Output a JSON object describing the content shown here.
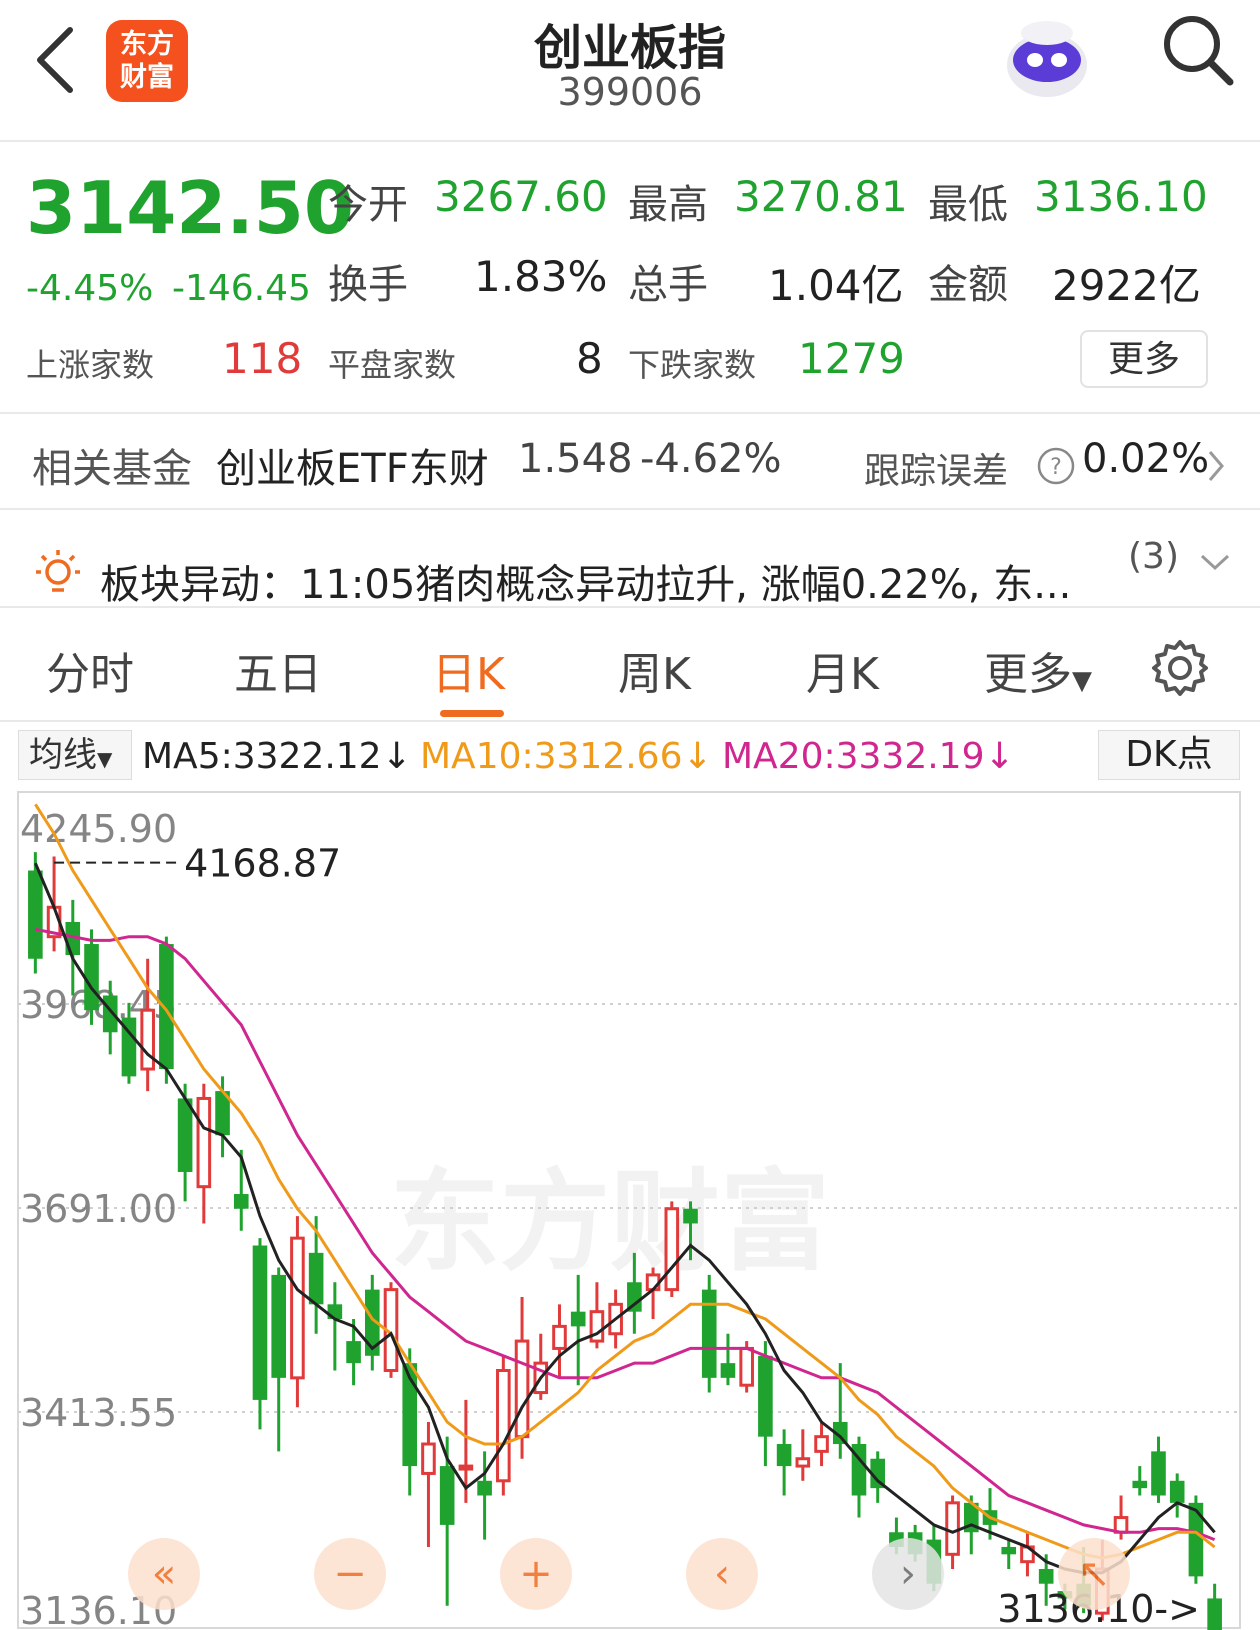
{
  "header": {
    "title": "创业板指",
    "code": "399006",
    "logo_line1": "东方",
    "logo_line2": "财富"
  },
  "quote": {
    "price": "3142.50",
    "change_pct": "-4.45%",
    "change": "-146.45",
    "open_label": "今开",
    "open": "3267.60",
    "high_label": "最高",
    "high": "3270.81",
    "low_label": "最低",
    "low": "3136.10",
    "turnover_label": "换手",
    "turnover": "1.83%",
    "volume_label": "总手",
    "volume": "1.04亿",
    "amount_label": "金额",
    "amount": "2922亿",
    "up_label": "上涨家数",
    "up": "118",
    "flat_label": "平盘家数",
    "flat": "8",
    "down_label": "下跌家数",
    "down": "1279",
    "more": "更多"
  },
  "fund": {
    "label": "相关基金",
    "name": "创业板ETF东财",
    "price": "1.548",
    "pct": "-4.62%",
    "err_label": "跟踪误差",
    "err": "0.02%"
  },
  "alert": {
    "text": "板块异动：11:05猪肉概念异动拉升, 涨幅0.22%, 东...",
    "count": "(3)"
  },
  "tabs": [
    "分时",
    "五日",
    "日K",
    "周K",
    "月K",
    "更多"
  ],
  "ma": {
    "selector": "均线",
    "ma5": "MA5:3322.12↓",
    "ma10": "MA10:3312.66↓",
    "ma20": "MA20:3332.19↓",
    "dk": "DK点",
    "ma5_color": "#222222",
    "ma10_color": "#f09a1a",
    "ma20_color": "#d0268f"
  },
  "chart_data": {
    "type": "candlestick",
    "y_ticks": [
      "4245.90",
      "3968.45",
      "3691.00",
      "3413.55",
      "3136.10"
    ],
    "ylim": [
      3136.1,
      4245.9
    ],
    "high_annotation": "4168.87",
    "low_annotation": "3136.10->",
    "watermark": "东方财富",
    "up_color": "#e03a3a",
    "down_color": "#1fa22e",
    "candles": [
      {
        "o": 4150,
        "c": 4030,
        "h": 4175,
        "l": 4010
      },
      {
        "o": 4060,
        "c": 4100,
        "h": 4169,
        "l": 4040
      },
      {
        "o": 4080,
        "c": 4035,
        "h": 4110,
        "l": 3980
      },
      {
        "o": 4050,
        "c": 3960,
        "h": 4070,
        "l": 3940
      },
      {
        "o": 3980,
        "c": 3930,
        "h": 4000,
        "l": 3900
      },
      {
        "o": 3950,
        "c": 3870,
        "h": 3970,
        "l": 3860
      },
      {
        "o": 3880,
        "c": 3960,
        "h": 4030,
        "l": 3850
      },
      {
        "o": 4050,
        "c": 3880,
        "h": 4060,
        "l": 3860
      },
      {
        "o": 3840,
        "c": 3740,
        "h": 3860,
        "l": 3700
      },
      {
        "o": 3720,
        "c": 3840,
        "h": 3860,
        "l": 3670
      },
      {
        "o": 3850,
        "c": 3790,
        "h": 3870,
        "l": 3760
      },
      {
        "o": 3710,
        "c": 3690,
        "h": 3770,
        "l": 3660
      },
      {
        "o": 3640,
        "c": 3430,
        "h": 3650,
        "l": 3390
      },
      {
        "o": 3600,
        "c": 3460,
        "h": 3610,
        "l": 3360
      },
      {
        "o": 3460,
        "c": 3650,
        "h": 3680,
        "l": 3420
      },
      {
        "o": 3630,
        "c": 3560,
        "h": 3680,
        "l": 3520
      },
      {
        "o": 3560,
        "c": 3540,
        "h": 3590,
        "l": 3470
      },
      {
        "o": 3510,
        "c": 3480,
        "h": 3540,
        "l": 3450
      },
      {
        "o": 3580,
        "c": 3490,
        "h": 3600,
        "l": 3470
      },
      {
        "o": 3470,
        "c": 3580,
        "h": 3590,
        "l": 3460
      },
      {
        "o": 3480,
        "c": 3340,
        "h": 3500,
        "l": 3300
      },
      {
        "o": 3330,
        "c": 3370,
        "h": 3400,
        "l": 3230
      },
      {
        "o": 3340,
        "c": 3260,
        "h": 3380,
        "l": 3150
      },
      {
        "o": 3340,
        "c": 3340,
        "h": 3430,
        "l": 3290
      },
      {
        "o": 3320,
        "c": 3300,
        "h": 3360,
        "l": 3240
      },
      {
        "o": 3320,
        "c": 3470,
        "h": 3490,
        "l": 3300
      },
      {
        "o": 3380,
        "c": 3510,
        "h": 3570,
        "l": 3350
      },
      {
        "o": 3440,
        "c": 3480,
        "h": 3520,
        "l": 3430
      },
      {
        "o": 3500,
        "c": 3530,
        "h": 3560,
        "l": 3460
      },
      {
        "o": 3550,
        "c": 3530,
        "h": 3600,
        "l": 3450
      },
      {
        "o": 3510,
        "c": 3550,
        "h": 3590,
        "l": 3500
      },
      {
        "o": 3520,
        "c": 3560,
        "h": 3580,
        "l": 3500
      },
      {
        "o": 3590,
        "c": 3550,
        "h": 3630,
        "l": 3520
      },
      {
        "o": 3580,
        "c": 3600,
        "h": 3610,
        "l": 3540
      },
      {
        "o": 3580,
        "c": 3690,
        "h": 3700,
        "l": 3570
      },
      {
        "o": 3690,
        "c": 3670,
        "h": 3700,
        "l": 3620
      },
      {
        "o": 3580,
        "c": 3460,
        "h": 3600,
        "l": 3440
      },
      {
        "o": 3480,
        "c": 3460,
        "h": 3520,
        "l": 3450
      },
      {
        "o": 3450,
        "c": 3500,
        "h": 3510,
        "l": 3440
      },
      {
        "o": 3490,
        "c": 3380,
        "h": 3510,
        "l": 3340
      },
      {
        "o": 3370,
        "c": 3340,
        "h": 3390,
        "l": 3300
      },
      {
        "o": 3340,
        "c": 3350,
        "h": 3390,
        "l": 3320
      },
      {
        "o": 3360,
        "c": 3380,
        "h": 3400,
        "l": 3340
      },
      {
        "o": 3400,
        "c": 3370,
        "h": 3480,
        "l": 3350
      },
      {
        "o": 3370,
        "c": 3300,
        "h": 3380,
        "l": 3270
      },
      {
        "o": 3350,
        "c": 3310,
        "h": 3360,
        "l": 3290
      },
      {
        "o": 3250,
        "c": 3230,
        "h": 3270,
        "l": 3220
      },
      {
        "o": 3250,
        "c": 3220,
        "h": 3260,
        "l": 3210
      },
      {
        "o": 3240,
        "c": 3180,
        "h": 3260,
        "l": 3170
      },
      {
        "o": 3220,
        "c": 3290,
        "h": 3300,
        "l": 3200
      },
      {
        "o": 3290,
        "c": 3250,
        "h": 3300,
        "l": 3220
      },
      {
        "o": 3280,
        "c": 3260,
        "h": 3310,
        "l": 3240
      },
      {
        "o": 3230,
        "c": 3220,
        "h": 3240,
        "l": 3200
      },
      {
        "o": 3210,
        "c": 3230,
        "h": 3250,
        "l": 3190
      },
      {
        "o": 3200,
        "c": 3180,
        "h": 3220,
        "l": 3150
      },
      {
        "o": 3170,
        "c": 3160,
        "h": 3180,
        "l": 3145
      },
      {
        "o": 3180,
        "c": 3150,
        "h": 3230,
        "l": 3140
      },
      {
        "o": 3140,
        "c": 3200,
        "h": 3240,
        "l": 3130
      },
      {
        "o": 3250,
        "c": 3270,
        "h": 3300,
        "l": 3240
      },
      {
        "o": 3320,
        "c": 3310,
        "h": 3340,
        "l": 3300
      },
      {
        "o": 3360,
        "c": 3300,
        "h": 3380,
        "l": 3290
      },
      {
        "o": 3320,
        "c": 3290,
        "h": 3330,
        "l": 3270
      },
      {
        "o": 3290,
        "c": 3190,
        "h": 3300,
        "l": 3180
      },
      {
        "o": 3160,
        "c": 3030,
        "h": 3180,
        "l": 3010
      }
    ],
    "ma5": [
      4160,
      4100,
      4030,
      3990,
      3960,
      3930,
      3900,
      3880,
      3840,
      3800,
      3790,
      3760,
      3680,
      3620,
      3580,
      3560,
      3540,
      3530,
      3500,
      3520,
      3460,
      3420,
      3350,
      3310,
      3330,
      3370,
      3420,
      3460,
      3490,
      3510,
      3520,
      3540,
      3560,
      3580,
      3610,
      3640,
      3620,
      3590,
      3560,
      3520,
      3470,
      3440,
      3400,
      3380,
      3350,
      3320,
      3300,
      3280,
      3260,
      3250,
      3260,
      3250,
      3240,
      3230,
      3210,
      3200,
      3195,
      3195,
      3210,
      3240,
      3270,
      3290,
      3280,
      3250
    ],
    "ma10": [
      4240,
      4200,
      4150,
      4110,
      4070,
      4030,
      3990,
      3960,
      3920,
      3880,
      3850,
      3820,
      3780,
      3730,
      3690,
      3660,
      3620,
      3580,
      3540,
      3520,
      3480,
      3440,
      3400,
      3380,
      3370,
      3370,
      3380,
      3400,
      3420,
      3440,
      3470,
      3490,
      3510,
      3520,
      3540,
      3560,
      3560,
      3560,
      3550,
      3540,
      3520,
      3500,
      3480,
      3460,
      3430,
      3410,
      3380,
      3360,
      3340,
      3310,
      3290,
      3270,
      3260,
      3250,
      3240,
      3230,
      3220,
      3215,
      3220,
      3230,
      3240,
      3250,
      3250,
      3230
    ],
    "ma20": [
      4070,
      4065,
      4060,
      4055,
      4055,
      4060,
      4060,
      4050,
      4030,
      4000,
      3970,
      3940,
      3890,
      3840,
      3790,
      3750,
      3710,
      3670,
      3630,
      3600,
      3570,
      3550,
      3530,
      3510,
      3500,
      3490,
      3480,
      3470,
      3460,
      3460,
      3460,
      3470,
      3480,
      3480,
      3490,
      3500,
      3500,
      3500,
      3500,
      3490,
      3480,
      3470,
      3460,
      3460,
      3450,
      3440,
      3420,
      3400,
      3380,
      3360,
      3340,
      3320,
      3300,
      3290,
      3280,
      3270,
      3260,
      3255,
      3250,
      3250,
      3255,
      3255,
      3250,
      3240
    ]
  }
}
